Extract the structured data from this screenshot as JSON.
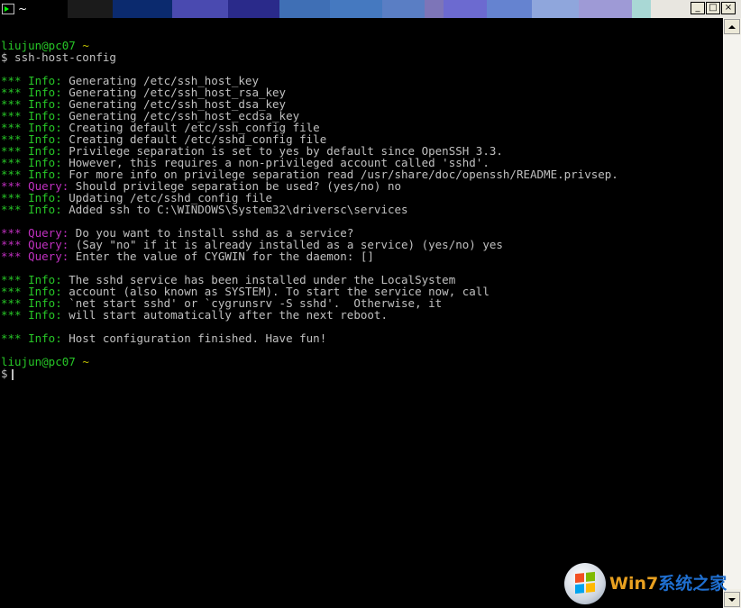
{
  "window": {
    "title": "~",
    "title_colors": [
      "#000000",
      "#1b1b1b",
      "#0b2a6e",
      "#4a4ab0",
      "#2a2a8a",
      "#3f6fb5",
      "#4579c0",
      "#5a7ec4",
      "#7d75b8",
      "#6c6ad0",
      "#6583d0",
      "#8fa6dc",
      "#9e9ad6",
      "#a9d8d5",
      "#e8e6e0"
    ],
    "buttons": {
      "minimize": "_",
      "maximize": "□",
      "close": "×"
    }
  },
  "terminal": {
    "colors": {
      "green": "#27c727",
      "yellow": "#c0c000",
      "magenta": "#c030c0",
      "text": "#c0c0c0",
      "background": "#000000"
    },
    "lines": [
      {
        "parts": [
          {
            "c": "green",
            "t": "liujun@pc07"
          },
          {
            "c": "yellow",
            "t": " ~"
          }
        ]
      },
      {
        "parts": [
          {
            "c": "white",
            "t": "$ ssh-host-config"
          }
        ]
      },
      {
        "parts": []
      },
      {
        "parts": [
          {
            "c": "green",
            "t": "*** Info:"
          },
          {
            "c": "white",
            "t": " Generating /etc/ssh_host_key"
          }
        ]
      },
      {
        "parts": [
          {
            "c": "green",
            "t": "*** Info:"
          },
          {
            "c": "white",
            "t": " Generating /etc/ssh_host_rsa_key"
          }
        ]
      },
      {
        "parts": [
          {
            "c": "green",
            "t": "*** Info:"
          },
          {
            "c": "white",
            "t": " Generating /etc/ssh_host_dsa_key"
          }
        ]
      },
      {
        "parts": [
          {
            "c": "green",
            "t": "*** Info:"
          },
          {
            "c": "white",
            "t": " Generating /etc/ssh_host_ecdsa_key"
          }
        ]
      },
      {
        "parts": [
          {
            "c": "green",
            "t": "*** Info:"
          },
          {
            "c": "white",
            "t": " Creating default /etc/ssh_config file"
          }
        ]
      },
      {
        "parts": [
          {
            "c": "green",
            "t": "*** Info:"
          },
          {
            "c": "white",
            "t": " Creating default /etc/sshd_config file"
          }
        ]
      },
      {
        "parts": [
          {
            "c": "green",
            "t": "*** Info:"
          },
          {
            "c": "white",
            "t": " Privilege separation is set to yes by default since OpenSSH 3.3."
          }
        ]
      },
      {
        "parts": [
          {
            "c": "green",
            "t": "*** Info:"
          },
          {
            "c": "white",
            "t": " However, this requires a non-privileged account called 'sshd'."
          }
        ]
      },
      {
        "parts": [
          {
            "c": "green",
            "t": "*** Info:"
          },
          {
            "c": "white",
            "t": " For more info on privilege separation read /usr/share/doc/openssh/README.privsep."
          }
        ]
      },
      {
        "parts": [
          {
            "c": "magenta",
            "t": "*** Query:"
          },
          {
            "c": "white",
            "t": " Should privilege separation be used? (yes/no) no"
          }
        ]
      },
      {
        "parts": [
          {
            "c": "green",
            "t": "*** Info:"
          },
          {
            "c": "white",
            "t": " Updating /etc/sshd_config file"
          }
        ]
      },
      {
        "parts": [
          {
            "c": "green",
            "t": "*** Info:"
          },
          {
            "c": "white",
            "t": " Added ssh to C:\\WINDOWS\\System32\\driversc\\services"
          }
        ]
      },
      {
        "parts": []
      },
      {
        "parts": [
          {
            "c": "magenta",
            "t": "*** Query:"
          },
          {
            "c": "white",
            "t": " Do you want to install sshd as a service?"
          }
        ]
      },
      {
        "parts": [
          {
            "c": "magenta",
            "t": "*** Query:"
          },
          {
            "c": "white",
            "t": " (Say \"no\" if it is already installed as a service) (yes/no) yes"
          }
        ]
      },
      {
        "parts": [
          {
            "c": "magenta",
            "t": "*** Query:"
          },
          {
            "c": "white",
            "t": " Enter the value of CYGWIN for the daemon: []"
          }
        ]
      },
      {
        "parts": []
      },
      {
        "parts": [
          {
            "c": "green",
            "t": "*** Info:"
          },
          {
            "c": "white",
            "t": " The sshd service has been installed under the LocalSystem"
          }
        ]
      },
      {
        "parts": [
          {
            "c": "green",
            "t": "*** Info:"
          },
          {
            "c": "white",
            "t": " account (also known as SYSTEM). To start the service now, call"
          }
        ]
      },
      {
        "parts": [
          {
            "c": "green",
            "t": "*** Info:"
          },
          {
            "c": "white",
            "t": " `net start sshd' or `cygrunsrv -S sshd'.  Otherwise, it"
          }
        ]
      },
      {
        "parts": [
          {
            "c": "green",
            "t": "*** Info:"
          },
          {
            "c": "white",
            "t": " will start automatically after the next reboot."
          }
        ]
      },
      {
        "parts": []
      },
      {
        "parts": [
          {
            "c": "green",
            "t": "*** Info:"
          },
          {
            "c": "white",
            "t": " Host configuration finished. Have fun!"
          }
        ]
      },
      {
        "parts": []
      },
      {
        "parts": [
          {
            "c": "green",
            "t": "liujun@pc07"
          },
          {
            "c": "yellow",
            "t": " ~"
          }
        ]
      },
      {
        "parts": [
          {
            "c": "white",
            "t": "$"
          }
        ],
        "cursor": true
      }
    ]
  },
  "watermark": {
    "brand": "Win7系统之家",
    "brand_colors": {
      "primary": "#e8a020",
      "secondary": "#1f6fd0"
    },
    "logo_icon": "windows-flag-icon",
    "flag_colors": [
      "#f25022",
      "#7fba00",
      "#00a4ef",
      "#ffb900"
    ]
  }
}
